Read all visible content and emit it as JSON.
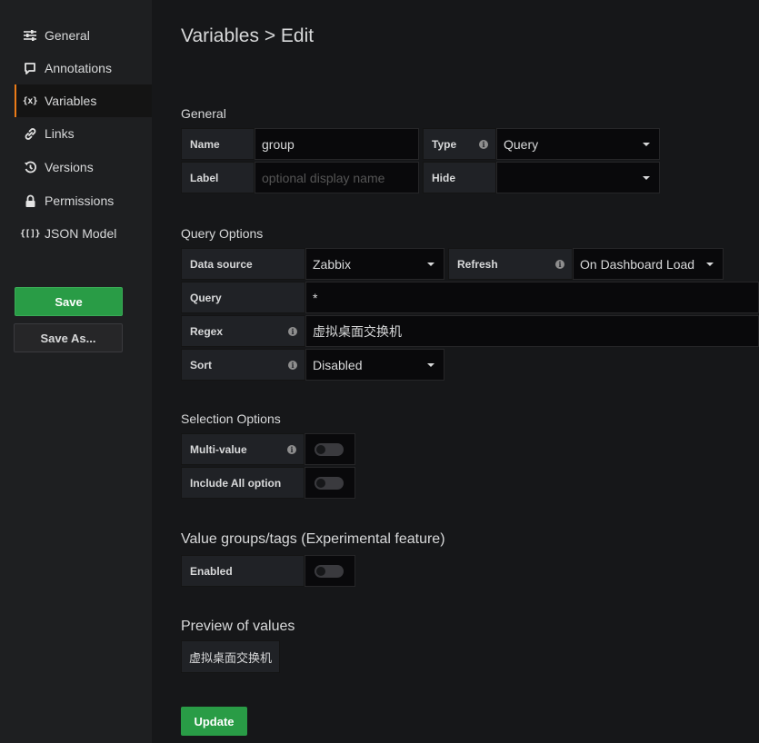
{
  "sidebar": {
    "items": [
      {
        "label": "General",
        "icon": "sliders-icon"
      },
      {
        "label": "Annotations",
        "icon": "comment-icon"
      },
      {
        "label": "Variables",
        "icon": "variable-icon",
        "icon_text": "{x}",
        "active": true
      },
      {
        "label": "Links",
        "icon": "link-icon"
      },
      {
        "label": "Versions",
        "icon": "history-icon"
      },
      {
        "label": "Permissions",
        "icon": "lock-icon"
      },
      {
        "label": "JSON Model",
        "icon": "json-icon",
        "icon_text": "{[]}"
      }
    ],
    "save_label": "Save",
    "save_as_label": "Save As..."
  },
  "page": {
    "title": "Variables > Edit"
  },
  "general": {
    "title": "General",
    "name_label": "Name",
    "name_value": "group",
    "type_label": "Type",
    "type_value": "Query",
    "label_label": "Label",
    "label_placeholder": "optional display name",
    "hide_label": "Hide",
    "hide_value": ""
  },
  "query_options": {
    "title": "Query Options",
    "datasource_label": "Data source",
    "datasource_value": "Zabbix",
    "refresh_label": "Refresh",
    "refresh_value": "On Dashboard Load",
    "query_label": "Query",
    "query_value": "*",
    "regex_label": "Regex",
    "regex_value": "虚拟桌面交换机",
    "sort_label": "Sort",
    "sort_value": "Disabled"
  },
  "selection_options": {
    "title": "Selection Options",
    "multi_label": "Multi-value",
    "include_all_label": "Include All option"
  },
  "value_groups": {
    "title": "Value groups/tags (Experimental feature)",
    "enabled_label": "Enabled"
  },
  "preview": {
    "title": "Preview of values",
    "values": [
      "虚拟桌面交换机"
    ]
  },
  "update_label": "Update",
  "colors": {
    "accent": "#eb7b18",
    "primary": "#299c46",
    "background": "#161719"
  }
}
